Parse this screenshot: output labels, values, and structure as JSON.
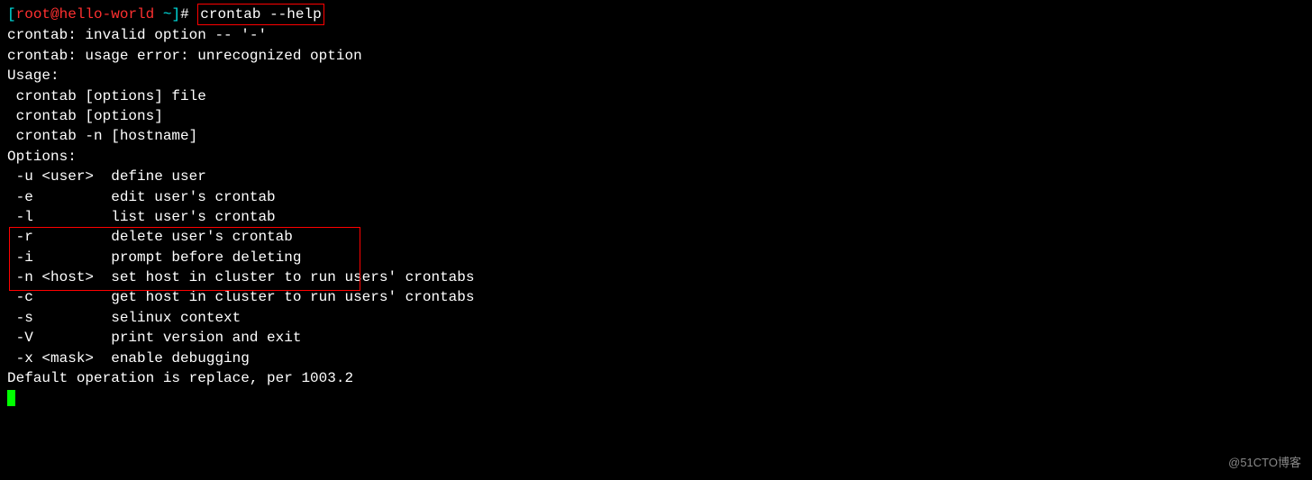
{
  "prompt": {
    "open_bracket": "[",
    "user": "root",
    "at": "@",
    "host": "hello-world",
    "path": " ~",
    "close_bracket": "]",
    "hash": "# "
  },
  "command": "crontab --help",
  "output": {
    "line1": "crontab: invalid option -- '-'",
    "line2": "crontab: usage error: unrecognized option",
    "line3": "Usage:",
    "line4": " crontab [options] file",
    "line5": " crontab [options]",
    "line6": " crontab -n [hostname]",
    "line7": "",
    "line8": "Options:",
    "line9": " -u <user>  define user",
    "line10": " -e         edit user's crontab",
    "line11": " -l         list user's crontab",
    "line12": " -r         delete user's crontab",
    "line13": " -i         prompt before deleting",
    "line14": " -n <host>  set host in cluster to run users' crontabs",
    "line15": " -c         get host in cluster to run users' crontabs",
    "line16": " -s         selinux context",
    "line17": " -V         print version and exit",
    "line18": " -x <mask>  enable debugging",
    "line19": "",
    "line20": "Default operation is replace, per 1003.2"
  },
  "watermark": "@51CTO博客"
}
